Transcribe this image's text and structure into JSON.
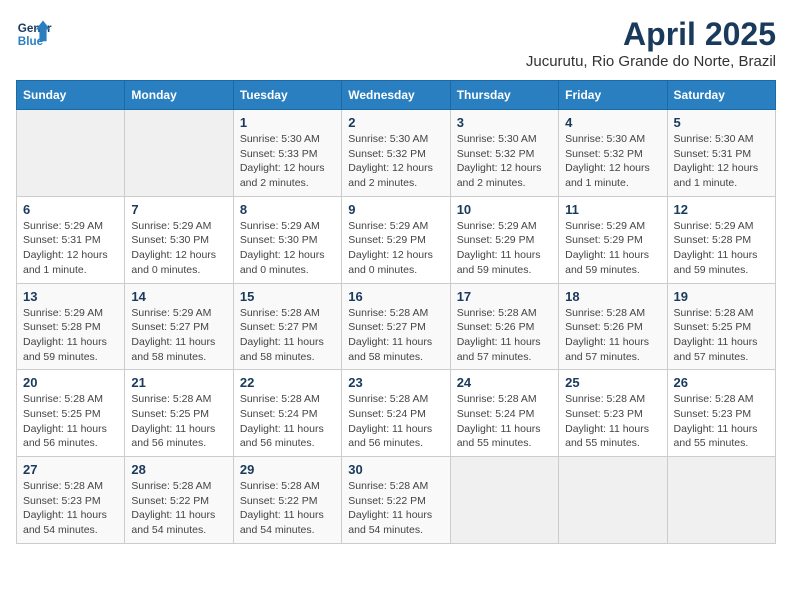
{
  "logo": {
    "line1": "General",
    "line2": "Blue"
  },
  "title": "April 2025",
  "subtitle": "Jucurutu, Rio Grande do Norte, Brazil",
  "weekdays": [
    "Sunday",
    "Monday",
    "Tuesday",
    "Wednesday",
    "Thursday",
    "Friday",
    "Saturday"
  ],
  "weeks": [
    [
      {
        "day": "",
        "info": ""
      },
      {
        "day": "",
        "info": ""
      },
      {
        "day": "1",
        "info": "Sunrise: 5:30 AM\nSunset: 5:33 PM\nDaylight: 12 hours and 2 minutes."
      },
      {
        "day": "2",
        "info": "Sunrise: 5:30 AM\nSunset: 5:32 PM\nDaylight: 12 hours and 2 minutes."
      },
      {
        "day": "3",
        "info": "Sunrise: 5:30 AM\nSunset: 5:32 PM\nDaylight: 12 hours and 2 minutes."
      },
      {
        "day": "4",
        "info": "Sunrise: 5:30 AM\nSunset: 5:32 PM\nDaylight: 12 hours and 1 minute."
      },
      {
        "day": "5",
        "info": "Sunrise: 5:30 AM\nSunset: 5:31 PM\nDaylight: 12 hours and 1 minute."
      }
    ],
    [
      {
        "day": "6",
        "info": "Sunrise: 5:29 AM\nSunset: 5:31 PM\nDaylight: 12 hours and 1 minute."
      },
      {
        "day": "7",
        "info": "Sunrise: 5:29 AM\nSunset: 5:30 PM\nDaylight: 12 hours and 0 minutes."
      },
      {
        "day": "8",
        "info": "Sunrise: 5:29 AM\nSunset: 5:30 PM\nDaylight: 12 hours and 0 minutes."
      },
      {
        "day": "9",
        "info": "Sunrise: 5:29 AM\nSunset: 5:29 PM\nDaylight: 12 hours and 0 minutes."
      },
      {
        "day": "10",
        "info": "Sunrise: 5:29 AM\nSunset: 5:29 PM\nDaylight: 11 hours and 59 minutes."
      },
      {
        "day": "11",
        "info": "Sunrise: 5:29 AM\nSunset: 5:29 PM\nDaylight: 11 hours and 59 minutes."
      },
      {
        "day": "12",
        "info": "Sunrise: 5:29 AM\nSunset: 5:28 PM\nDaylight: 11 hours and 59 minutes."
      }
    ],
    [
      {
        "day": "13",
        "info": "Sunrise: 5:29 AM\nSunset: 5:28 PM\nDaylight: 11 hours and 59 minutes."
      },
      {
        "day": "14",
        "info": "Sunrise: 5:29 AM\nSunset: 5:27 PM\nDaylight: 11 hours and 58 minutes."
      },
      {
        "day": "15",
        "info": "Sunrise: 5:28 AM\nSunset: 5:27 PM\nDaylight: 11 hours and 58 minutes."
      },
      {
        "day": "16",
        "info": "Sunrise: 5:28 AM\nSunset: 5:27 PM\nDaylight: 11 hours and 58 minutes."
      },
      {
        "day": "17",
        "info": "Sunrise: 5:28 AM\nSunset: 5:26 PM\nDaylight: 11 hours and 57 minutes."
      },
      {
        "day": "18",
        "info": "Sunrise: 5:28 AM\nSunset: 5:26 PM\nDaylight: 11 hours and 57 minutes."
      },
      {
        "day": "19",
        "info": "Sunrise: 5:28 AM\nSunset: 5:25 PM\nDaylight: 11 hours and 57 minutes."
      }
    ],
    [
      {
        "day": "20",
        "info": "Sunrise: 5:28 AM\nSunset: 5:25 PM\nDaylight: 11 hours and 56 minutes."
      },
      {
        "day": "21",
        "info": "Sunrise: 5:28 AM\nSunset: 5:25 PM\nDaylight: 11 hours and 56 minutes."
      },
      {
        "day": "22",
        "info": "Sunrise: 5:28 AM\nSunset: 5:24 PM\nDaylight: 11 hours and 56 minutes."
      },
      {
        "day": "23",
        "info": "Sunrise: 5:28 AM\nSunset: 5:24 PM\nDaylight: 11 hours and 56 minutes."
      },
      {
        "day": "24",
        "info": "Sunrise: 5:28 AM\nSunset: 5:24 PM\nDaylight: 11 hours and 55 minutes."
      },
      {
        "day": "25",
        "info": "Sunrise: 5:28 AM\nSunset: 5:23 PM\nDaylight: 11 hours and 55 minutes."
      },
      {
        "day": "26",
        "info": "Sunrise: 5:28 AM\nSunset: 5:23 PM\nDaylight: 11 hours and 55 minutes."
      }
    ],
    [
      {
        "day": "27",
        "info": "Sunrise: 5:28 AM\nSunset: 5:23 PM\nDaylight: 11 hours and 54 minutes."
      },
      {
        "day": "28",
        "info": "Sunrise: 5:28 AM\nSunset: 5:22 PM\nDaylight: 11 hours and 54 minutes."
      },
      {
        "day": "29",
        "info": "Sunrise: 5:28 AM\nSunset: 5:22 PM\nDaylight: 11 hours and 54 minutes."
      },
      {
        "day": "30",
        "info": "Sunrise: 5:28 AM\nSunset: 5:22 PM\nDaylight: 11 hours and 54 minutes."
      },
      {
        "day": "",
        "info": ""
      },
      {
        "day": "",
        "info": ""
      },
      {
        "day": "",
        "info": ""
      }
    ]
  ]
}
